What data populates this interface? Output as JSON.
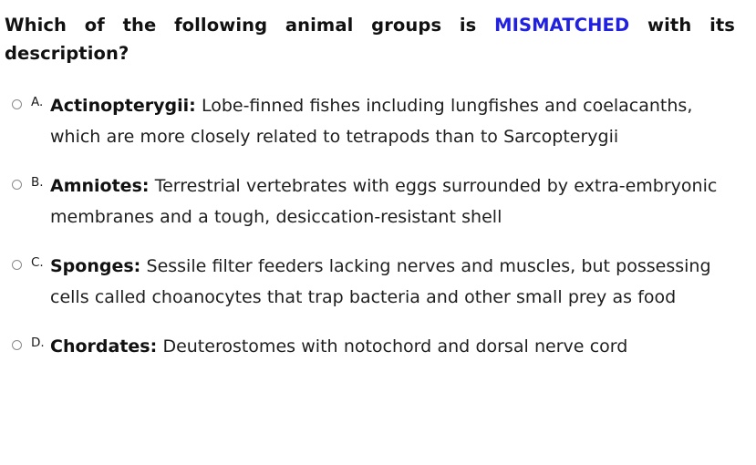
{
  "question": {
    "text_before": "Which of the following animal groups is ",
    "keyword": "MISMATCHED",
    "text_after": " with its description?",
    "keyword_color": "#2020e0"
  },
  "options": [
    {
      "letter": "A.",
      "term": "Actinopterygii:",
      "description": " Lobe-finned fishes including lungfishes and coelacanths, which are more closely related to tetrapods than to Sarcopterygii",
      "radio_icon": "radio-unselected-icon",
      "selected": false
    },
    {
      "letter": "B.",
      "term": "Amniotes:",
      "description": " Terrestrial vertebrates with eggs surrounded by extra-embryonic membranes and a tough, desiccation-resistant shell",
      "radio_icon": "radio-unselected-icon",
      "selected": false
    },
    {
      "letter": "C.",
      "term": "Sponges:",
      "description": " Sessile filter feeders lacking nerves and muscles, but possessing cells called choanocytes that trap bacteria and other small prey as food",
      "radio_icon": "radio-unselected-icon",
      "selected": false
    },
    {
      "letter": "D.",
      "term": "Chordates:",
      "description": " Deuterostomes with notochord and dorsal nerve cord",
      "radio_icon": "radio-unselected-icon",
      "selected": false
    }
  ]
}
